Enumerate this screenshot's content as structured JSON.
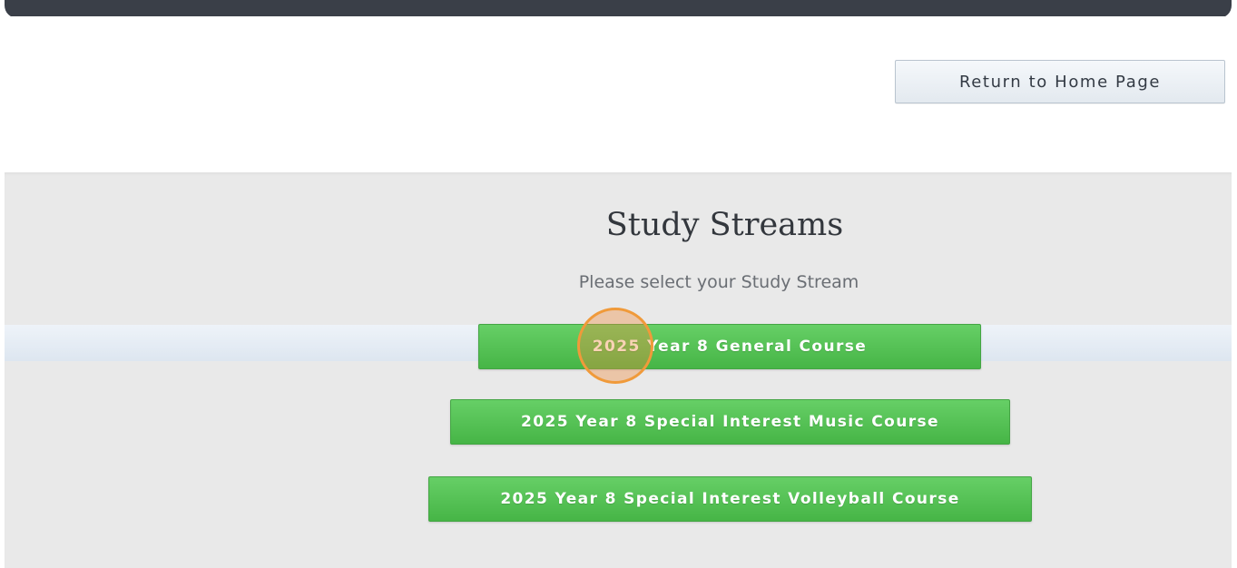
{
  "header": {
    "home_button_label": "Return to Home Page"
  },
  "main": {
    "title": "Study Streams",
    "subtitle": "Please select your Study Stream",
    "streams": [
      {
        "label": "2025 Year 8 General Course"
      },
      {
        "label": "2025 Year 8 Special Interest Music Course"
      },
      {
        "label": "2025 Year 8 Special Interest Volleyball Course"
      }
    ]
  },
  "colors": {
    "accent_green": "#4cbc4c",
    "header_bar": "#3a3f48",
    "content_background": "#e9e9e9",
    "click_indicator": "#f09a3a"
  }
}
